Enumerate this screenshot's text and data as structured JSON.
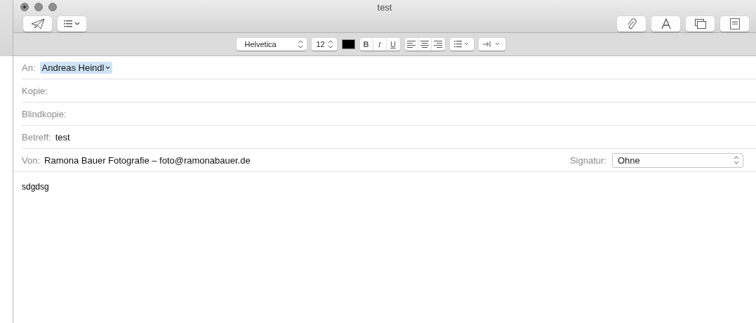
{
  "window": {
    "title": "test"
  },
  "format_bar": {
    "font": "Helvetica",
    "size": "12",
    "styles": [
      "B",
      "I",
      "U"
    ]
  },
  "fields": [
    {
      "label": "An:",
      "kind": "tokens",
      "tokens": [
        "Andreas Heindl"
      ]
    },
    {
      "label": "Kopie:",
      "kind": "empty"
    },
    {
      "label": "Blindkopie:",
      "kind": "empty"
    },
    {
      "label": "Betreff:",
      "kind": "text",
      "value": "test"
    }
  ],
  "from": {
    "label": "Von:",
    "value": "Ramona Bauer Fotografie – foto@ramonabauer.de"
  },
  "signature": {
    "label": "Signatur:",
    "value": "Ohne"
  },
  "body": "sdgdsg"
}
